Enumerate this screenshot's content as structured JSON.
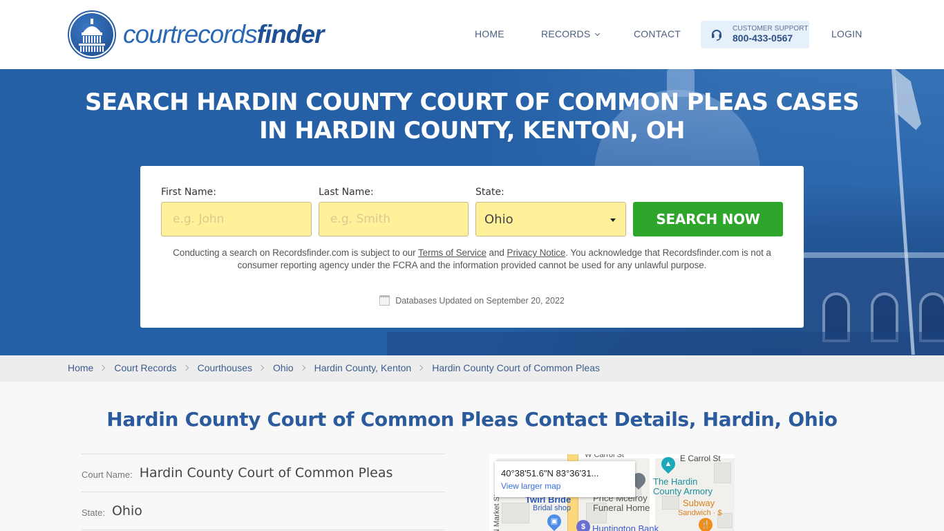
{
  "header": {
    "logo": {
      "part1": "courtrecords",
      "part2": "finder"
    },
    "nav": [
      {
        "label": "HOME"
      },
      {
        "label": "RECORDS"
      },
      {
        "label": "CONTACT"
      }
    ],
    "support": {
      "label": "CUSTOMER SUPPORT",
      "phone": "800-433-0567"
    },
    "login": "LOGIN"
  },
  "hero": {
    "title": "SEARCH HARDIN COUNTY COURT OF COMMON PLEAS CASES IN HARDIN COUNTY, KENTON, OH",
    "form": {
      "first_name": {
        "label": "First Name:",
        "placeholder": "e.g. John",
        "value": ""
      },
      "last_name": {
        "label": "Last Name:",
        "placeholder": "e.g. Smith",
        "value": ""
      },
      "state": {
        "label": "State:",
        "selected": "Ohio"
      },
      "submit": "SEARCH NOW"
    },
    "disclaimer": {
      "pre": "Conducting a search on Recordsfinder.com is subject to our ",
      "terms": "Terms of Service",
      "and": " and ",
      "privacy": "Privacy Notice",
      "post": ". You acknowledge that Recordsfinder.com is not a consumer reporting agency under the FCRA and the information provided cannot be used for any unlawful purpose."
    },
    "updated": "Databases Updated on September 20, 2022"
  },
  "breadcrumb": [
    "Home",
    "Court Records",
    "Courthouses",
    "Ohio",
    "Hardin County, Kenton",
    "Hardin County Court of Common Pleas"
  ],
  "main": {
    "title": "Hardin County Court of Common Pleas Contact Details, Hardin, Ohio",
    "details": [
      {
        "key": "Court Name:",
        "value": "Hardin County Court of Common Pleas"
      },
      {
        "key": "State:",
        "value": "Ohio"
      }
    ]
  },
  "map": {
    "coords": "40°38'51.6\"N 83°36'31...",
    "link": "View larger map",
    "labels": {
      "carrol_w": "W Carrol St",
      "carrol_e": "E Carrol St",
      "armory": "The Hardin County Armory",
      "armory_1": "The Hardin",
      "armory_2": "County Armory",
      "subway": "Subway",
      "subway_sub": "Sandwich · $",
      "twirl": "Twirl Bride",
      "twirl_sub": "Bridal shop",
      "funeral_1": "Price Mcelroy",
      "funeral_2": "Funeral Home",
      "bank": "Huntington Bank",
      "market": "N Market St"
    }
  }
}
